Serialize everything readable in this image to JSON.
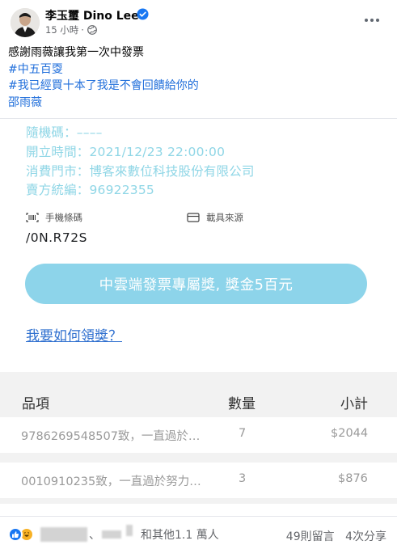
{
  "post": {
    "author": "李玉璽 Dino Lee",
    "time": "15 小時",
    "dot": "·",
    "lines": [
      {
        "text": "感謝雨薇讓我第一次中發票",
        "hashtag": false
      },
      {
        "text": "#中五百㪅",
        "hashtag": true
      },
      {
        "text": "#我已經買十本了我是不會回饋給你的",
        "hashtag": true
      },
      {
        "text": "邵雨薇",
        "hashtag": true
      }
    ]
  },
  "receipt": {
    "random_code": "隨機碼：––––",
    "issue_time": "開立時間：2021/12/23 22:00:00",
    "store": "消費門市：博客來數位科技股份有限公司",
    "seller_id": "賣方統編：96922355",
    "phone_barcode_label": "手機條碼",
    "phone_barcode_value": "/0N.R72S",
    "carrier_source_label": "載具來源",
    "prize_button": "中雲端發票專屬獎, 獎金5百元",
    "claim_link": "我要如何領獎？"
  },
  "items_table": {
    "headers": {
      "name": "品項",
      "qty": "數量",
      "subtotal": "小計"
    },
    "rows": [
      {
        "name": "9786269548507致，一直過於…",
        "qty": "7",
        "subtotal": "$2044"
      },
      {
        "name": "0010910235致，一直過於努力…",
        "qty": "3",
        "subtotal": "$876"
      }
    ]
  },
  "footer": {
    "separator": "、",
    "reaction_text": "和其他1.1 萬人",
    "comments": "49則留言",
    "shares": "4次分享"
  },
  "icons": {
    "verified": "verified-badge-icon",
    "globe": "globe-icon",
    "more": "more-options-icon",
    "barcode": "barcode-icon",
    "card": "card-icon",
    "like": "like-reaction-icon",
    "haha": "haha-reaction-icon"
  },
  "colors": {
    "hashtag": "#216fdb",
    "receipt_field": "#8fd6e6",
    "prize_button": "#8dd4ea",
    "claim_link": "#2e6fcf",
    "verified": "#1877f2"
  }
}
